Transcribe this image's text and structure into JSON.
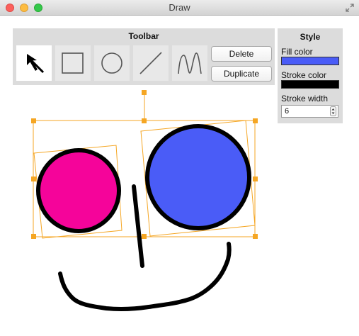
{
  "window": {
    "title": "Draw"
  },
  "toolbar": {
    "title": "Toolbar",
    "tools": [
      {
        "name": "select",
        "icon": "arrow-pointer-icon",
        "selected": true
      },
      {
        "name": "rectangle",
        "icon": "rectangle-icon",
        "selected": false
      },
      {
        "name": "circle",
        "icon": "circle-icon",
        "selected": false
      },
      {
        "name": "line",
        "icon": "line-icon",
        "selected": false
      },
      {
        "name": "freehand",
        "icon": "freehand-curve-icon",
        "selected": false
      }
    ],
    "delete_label": "Delete",
    "duplicate_label": "Duplicate"
  },
  "style": {
    "title": "Style",
    "fill_color_label": "Fill color",
    "fill_color": "#4a5cf7",
    "stroke_color_label": "Stroke color",
    "stroke_color": "#000000",
    "stroke_width_label": "Stroke width",
    "stroke_width": "6"
  },
  "canvas": {
    "selection_color": "#f5a623",
    "shapes": [
      {
        "type": "circle",
        "fill": "#f5049a",
        "stroke": "#000000"
      },
      {
        "type": "circle",
        "fill": "#4a5cf7",
        "stroke": "#000000"
      },
      {
        "type": "line",
        "stroke": "#000000"
      },
      {
        "type": "freehand",
        "stroke": "#000000"
      }
    ]
  }
}
